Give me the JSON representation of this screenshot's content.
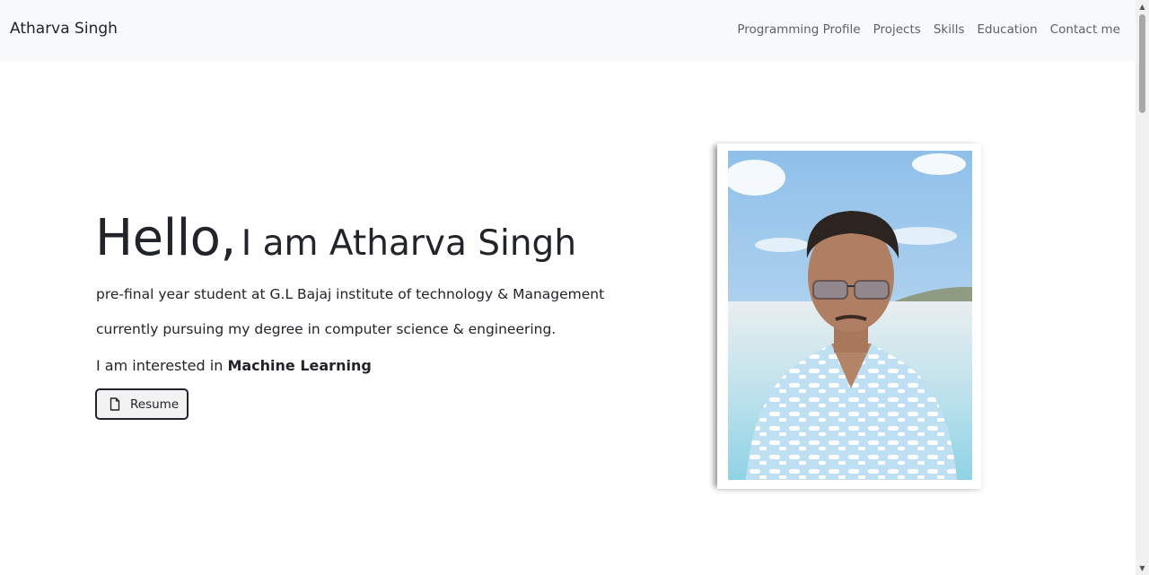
{
  "navbar": {
    "brand": "Atharva Singh",
    "links": [
      "Programming Profile",
      "Projects",
      "Skills",
      "Education",
      "Contact me"
    ]
  },
  "hero": {
    "greeting": "Hello,",
    "intro": "I am Atharva Singh",
    "line1": "pre-final year student at G.L Bajaj institute of technology & Management",
    "line2": "currently pursuing my degree in computer science & engineering.",
    "interest_prefix": "I am interested in",
    "interest": "Machine Learning",
    "resume_label": "Resume"
  },
  "icons": {
    "resume": "file-icon"
  }
}
